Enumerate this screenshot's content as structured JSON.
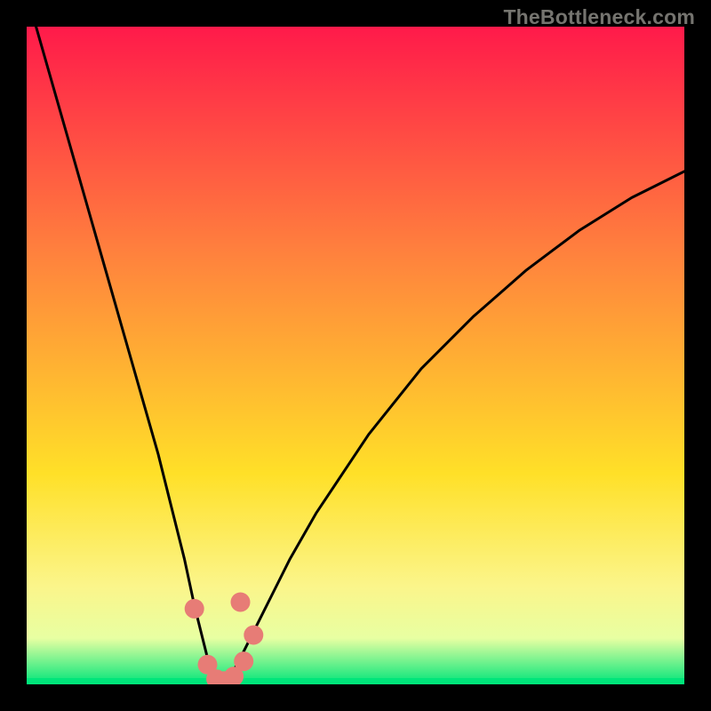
{
  "watermark": "TheBottleneck.com",
  "colors": {
    "bg": "#000000",
    "grad_top": "#ff1a4a",
    "grad_upper_mid": "#ff833d",
    "grad_mid": "#ffe028",
    "grad_lower_mid": "#fbf58a",
    "grad_band": "#e8ffa2",
    "grad_bottom_line": "#00e57a",
    "curve": "#000000",
    "dots": "#e77c76"
  },
  "chart_data": {
    "type": "line",
    "title": "",
    "xlabel": "",
    "ylabel": "",
    "xlim": [
      0,
      100
    ],
    "ylim": [
      0,
      100
    ],
    "curve": {
      "x": [
        0,
        2,
        4,
        6,
        8,
        10,
        12,
        14,
        16,
        18,
        20,
        22,
        24,
        25.5,
        27,
        28,
        29,
        30,
        32,
        34,
        36,
        38,
        40,
        44,
        48,
        52,
        56,
        60,
        64,
        68,
        72,
        76,
        80,
        84,
        88,
        92,
        96,
        100
      ],
      "y": [
        105,
        98,
        91,
        84,
        77,
        70,
        63,
        56,
        49,
        42,
        35,
        27,
        19,
        12,
        6,
        2,
        0,
        0,
        3,
        7,
        11,
        15,
        19,
        26,
        32,
        38,
        43,
        48,
        52,
        56,
        59.5,
        63,
        66,
        69,
        71.5,
        74,
        76,
        78
      ]
    },
    "series": [
      {
        "name": "data-points",
        "x": [
          25.5,
          27.5,
          28.8,
          30.0,
          31.5,
          33.0,
          34.5,
          32.5
        ],
        "y": [
          11.5,
          3.0,
          0.8,
          0.5,
          1.2,
          3.5,
          7.5,
          12.5
        ]
      }
    ]
  }
}
